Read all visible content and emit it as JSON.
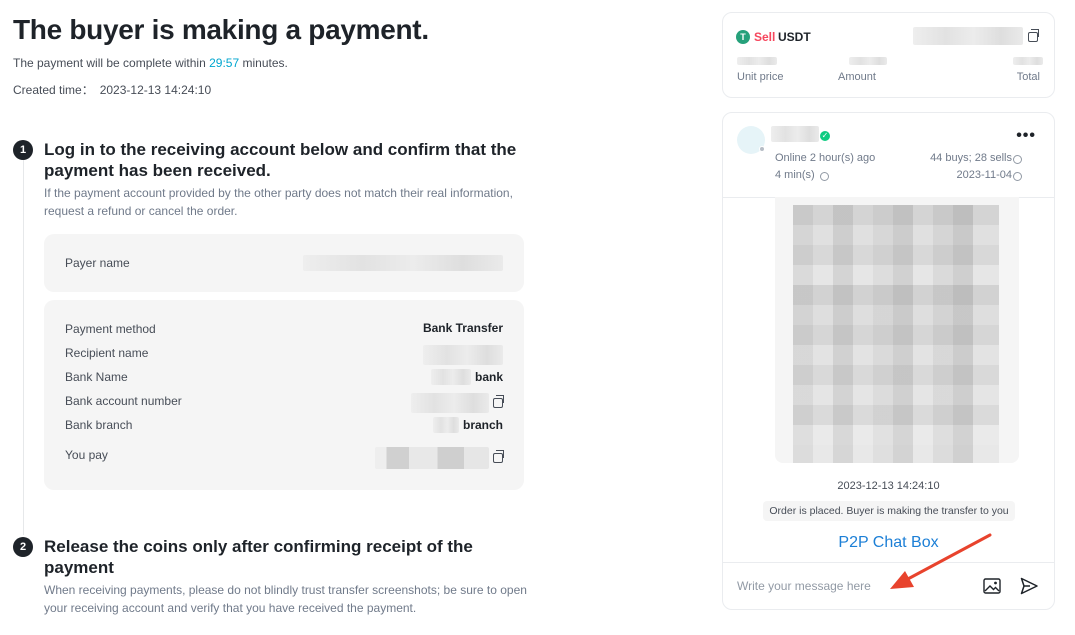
{
  "header": {
    "title": "The buyer is making a payment.",
    "subtitle_prefix": "The payment will be complete within",
    "timer": "29:57",
    "subtitle_suffix": "minutes.",
    "created_label": "Created time：",
    "created_value": "2023-12-13 14:24:10"
  },
  "step1": {
    "number": "1",
    "title": "Log in to the receiving account below and confirm that the payment has been received.",
    "description": "If the payment account provided by the other party does not match their real information, request a refund or cancel the order.",
    "payer_label": "Payer name",
    "rows": [
      {
        "label": "Payment method",
        "value": "Bank Transfer"
      },
      {
        "label": "Recipient name",
        "value": ""
      },
      {
        "label": "Bank Name",
        "value": "bank"
      },
      {
        "label": "Bank account number",
        "value": ""
      },
      {
        "label": "Bank branch",
        "value": "branch"
      },
      {
        "label": "You pay",
        "value": ""
      }
    ]
  },
  "step2": {
    "number": "2",
    "title": "Release the coins only after confirming receipt of the payment",
    "description": "When receiving payments, please do not blindly trust transfer screenshots; be sure to open your receiving account and verify that you have received the payment."
  },
  "order": {
    "coin_icon": "T",
    "side": "Sell",
    "coin": "USDT",
    "unit_price_label": "Unit price",
    "amount_label": "Amount",
    "total_label": "Total"
  },
  "chat": {
    "online_status": "Online 2 hour(s) ago",
    "trades": "44 buys; 28 sells",
    "response_time": "4 min(s)",
    "join_date": "2023-11-04",
    "more": "•••",
    "message_time": "2023-12-13 14:24:10",
    "system_message": "Order is placed. Buyer is making the transfer to you",
    "annotation": "P2P Chat Box",
    "input_placeholder": "Write your message here"
  },
  "colors": {
    "accent_timer": "#00a6cf",
    "sell": "#f6465d",
    "tether": "#26a17b",
    "annotation": "#1c7fd6",
    "arrow": "#e8432d"
  }
}
